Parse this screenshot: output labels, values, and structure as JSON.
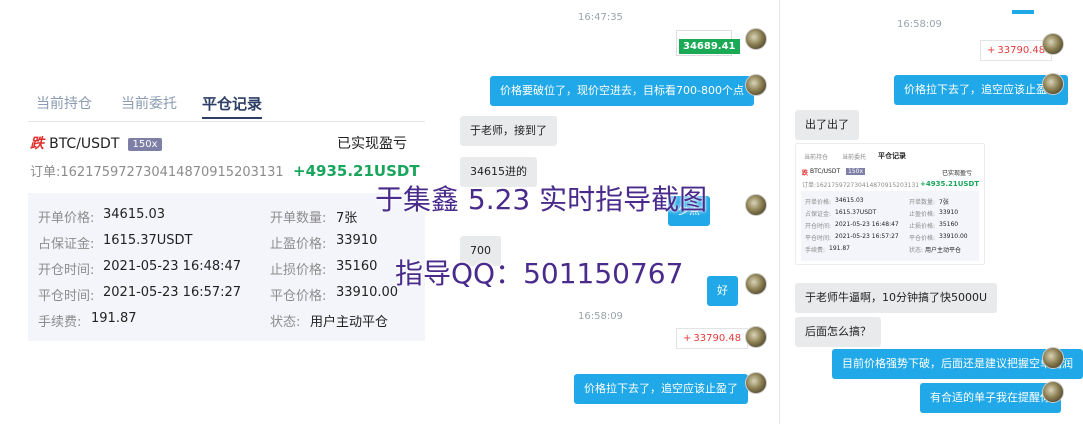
{
  "trade_record": {
    "tabs": [
      "当前持仓",
      "当前委托",
      "平仓记录"
    ],
    "active_tab": "平仓记录",
    "direction": "跌",
    "pair": "BTC/USDT",
    "leverage": "150x",
    "realized_label": "已实现盈亏",
    "order_line": "订单:162175972730414870915203131",
    "profit": "+4935.21USDT",
    "details": {
      "open_price_label": "开单价格:",
      "open_price": "34615.03",
      "quantity_label": "开单数量:",
      "quantity": "7张",
      "margin_label": "占保证金:",
      "margin": "1615.37USDT",
      "take_profit_label": "止盈价格:",
      "take_profit": "33910",
      "open_time_label": "开仓时间:",
      "open_time": "2021-05-23 16:48:47",
      "stop_loss_label": "止损价格:",
      "stop_loss": "35160",
      "close_time_label": "平仓时间:",
      "close_time": "2021-05-23 16:57:27",
      "close_price_label": "平仓价格:",
      "close_price": "33910.00",
      "fee_label": "手续费:",
      "fee": "191.87",
      "status_label": "状态:",
      "status": "用户主动平仓"
    }
  },
  "chat_mid": {
    "time1": "16:47:35",
    "price_top": "34689.41",
    "msg1": "价格要破位了，现价空进去，目标看700-800个点",
    "msg2": "于老师，接到了",
    "msg3": "34615进的",
    "msg4": "少点",
    "msg5": "700",
    "msg6": "好",
    "time2": "16:58:09",
    "price_card": "33790.48",
    "price_card_sign": "+",
    "msg7": "价格拉下去了，追空应该止盈了"
  },
  "chat_right": {
    "time1": "16:58:09",
    "price_card": "33790.48",
    "price_card_sign": "+",
    "msg1": "价格拉下去了，追空应该止盈了",
    "msg2": "出了出了",
    "mini": {
      "tabs": [
        "当前持仓",
        "当前委托",
        "平仓记录"
      ],
      "direction": "跌",
      "pair": "BTC/USDT",
      "leverage": "150x",
      "realized_label": "已实现盈亏",
      "order_line": "订单:162175972730414870915203131",
      "profit": "+4935.21USDT",
      "rows": [
        [
          "开单价格:",
          "34615.03",
          "开单数量:",
          "7张"
        ],
        [
          "占保证金:",
          "1615.37USDT",
          "止盈价格:",
          "33910"
        ],
        [
          "开仓时间:",
          "2021-05-23 16:48:47",
          "止损价格:",
          "35160"
        ],
        [
          "平仓时间:",
          "2021-05-23 16:57:27",
          "平仓价格:",
          "33910.00"
        ],
        [
          "手续费:",
          "191.87",
          "状态:",
          "用户主动平仓"
        ]
      ]
    },
    "msg3": "于老师牛逼啊，10分钟搞了快5000U",
    "msg4": "后面怎么搞？",
    "msg5": "目前价格强势下破，后面还是建议把握空单利润",
    "msg6": "有合适的单子我在提醒你"
  },
  "overlay": {
    "title": "于集鑫 5.23 实时指导截图",
    "qq": "指导QQ：501150767"
  },
  "colors": {
    "accent_blue": "#20a8e8",
    "profit_green": "#1aa55c",
    "down_red": "#e0302d",
    "overlay_purple": "#4a2b8c"
  }
}
